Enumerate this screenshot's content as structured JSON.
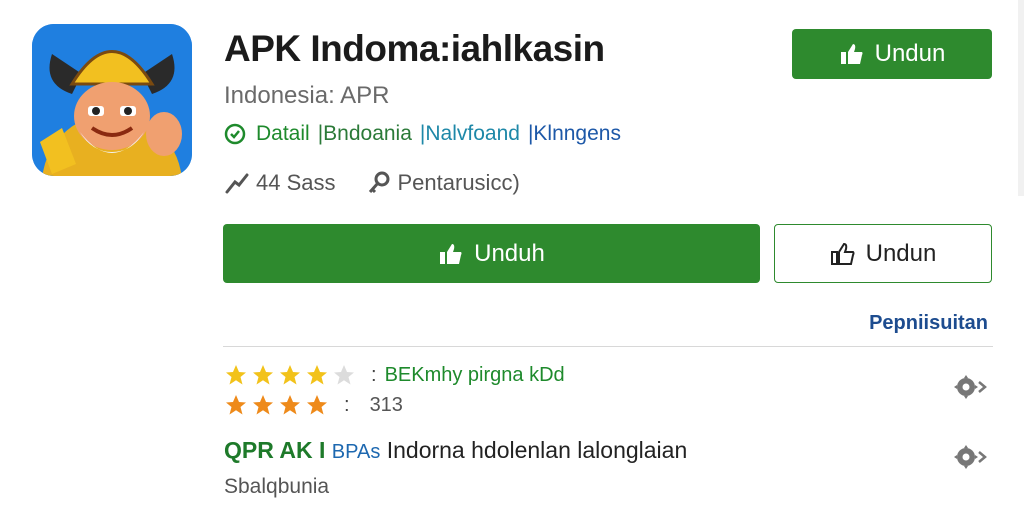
{
  "app": {
    "title": "APK Indoma:iahlkasin",
    "subtitle": "Indonesia: APR",
    "icon_name": "cartoon-viking-app-icon"
  },
  "tags": {
    "icon": "check-circle-icon",
    "items": [
      "Datail",
      "|Bndoania",
      "|Nalvfoand",
      "|Klnngens"
    ]
  },
  "meta": {
    "size_icon": "chart-trend-icon",
    "size_text": "44 Sass",
    "perm_icon": "key-icon",
    "perm_text": "Pentarusicc)"
  },
  "buttons": {
    "top_label": "Undun",
    "main_label": "Unduh",
    "outline_label": "Undun",
    "thumb_icon": "thumbs-up-icon"
  },
  "link_more": "Pepniisuitan",
  "ratings": [
    {
      "stars": 4,
      "max": 5,
      "label": "BEKmhy pirgna kDd",
      "colon": ":"
    },
    {
      "stars": 4,
      "max": 4,
      "count": "313",
      "colon": ":"
    }
  ],
  "section": {
    "title_a": "QPR AK I",
    "title_b": "BPAs",
    "title_c": "Indorna hdolenlan lalonglaian",
    "subtitle": "Sbalqbunia"
  },
  "colors": {
    "green": "#2e8a2e",
    "star_yellow": "#f2c21a",
    "star_orange": "#ee8a1a",
    "link_blue": "#1d4c8f"
  }
}
